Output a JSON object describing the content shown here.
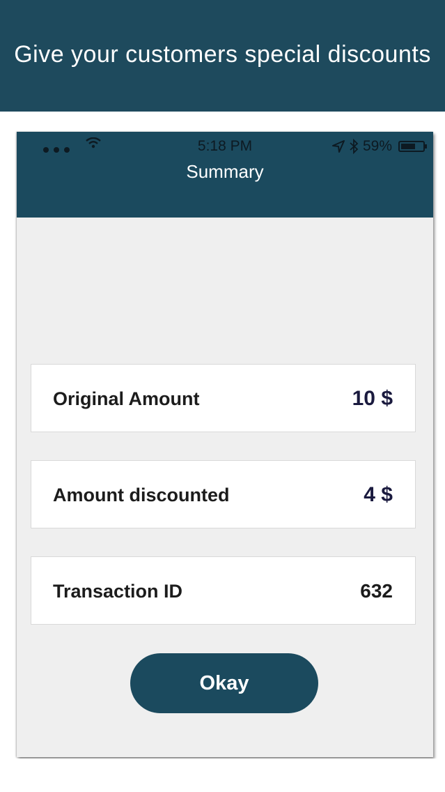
{
  "banner": {
    "text": "Give your customers special discounts"
  },
  "status_bar": {
    "time": "5:18 PM",
    "battery_percent": "59%"
  },
  "navbar": {
    "title": "Summary"
  },
  "summary": [
    {
      "label": "Original Amount",
      "value": "10 $"
    },
    {
      "label": "Amount discounted",
      "value": "4 $"
    },
    {
      "label": "Transaction ID",
      "value": "632"
    }
  ],
  "actions": {
    "okay_label": "Okay"
  },
  "colors": {
    "brand": "#1b4a5e",
    "background": "#efefef",
    "card": "#ffffff"
  },
  "icons": [
    "signal-dots-icon",
    "wifi-icon",
    "location-arrow-icon",
    "bluetooth-icon",
    "battery-icon"
  ]
}
